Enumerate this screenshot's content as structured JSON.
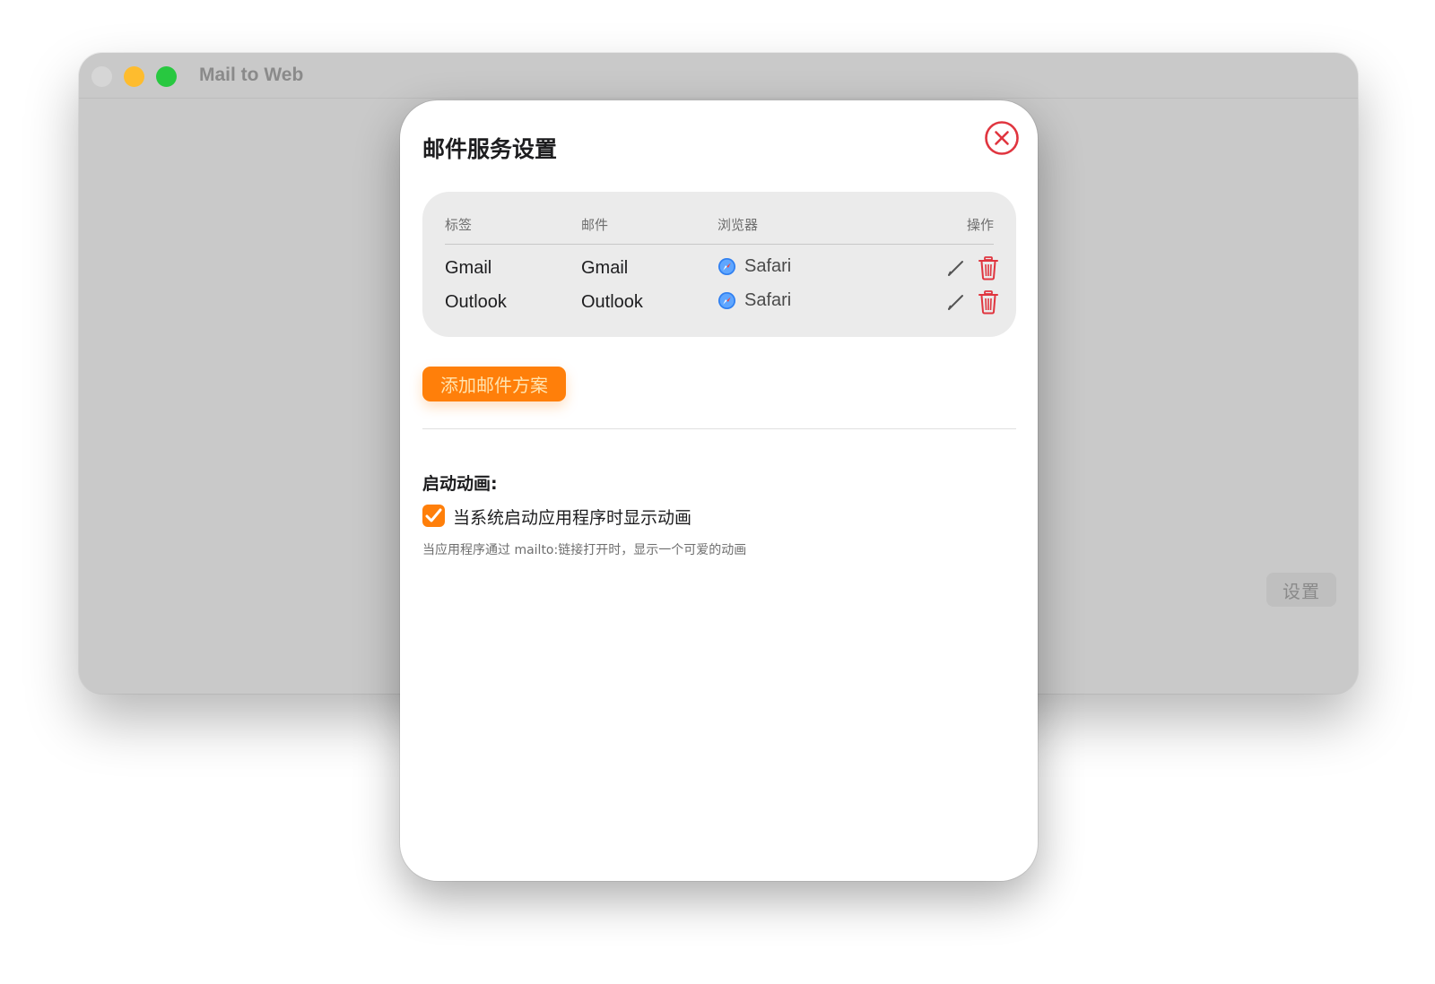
{
  "window": {
    "title": "Mail to Web",
    "settings_button": "设置"
  },
  "sheet": {
    "title": "邮件服务设置",
    "table": {
      "headers": {
        "label": "标签",
        "mail": "邮件",
        "browser": "浏览器",
        "actions": "操作"
      },
      "rows": [
        {
          "label": "Gmail",
          "mail": "Gmail",
          "browser": "Safari",
          "browser_icon": "safari-icon",
          "edit_icon": "pencil-icon",
          "delete_icon": "trash-icon"
        },
        {
          "label": "Outlook",
          "mail": "Outlook",
          "browser": "Safari",
          "browser_icon": "safari-icon",
          "edit_icon": "pencil-icon",
          "delete_icon": "trash-icon"
        }
      ]
    },
    "add_button": "添加邮件方案",
    "launch_animation": {
      "section_label": "启动动画:",
      "checkbox_label": "当系统启动应用程序时显示动画",
      "checked": true,
      "help_text": "当应用程序通过 mailto:链接打开时，显示一个可爱的动画"
    }
  },
  "colors": {
    "accent": "#ff7f0a",
    "close_icon": "#e0353f",
    "delete_icon": "#e0353f",
    "window_background": "#c9c9c9",
    "traffic_close": "#d6d6d6",
    "traffic_minimize": "#febc2e",
    "traffic_maximize": "#28c840"
  }
}
